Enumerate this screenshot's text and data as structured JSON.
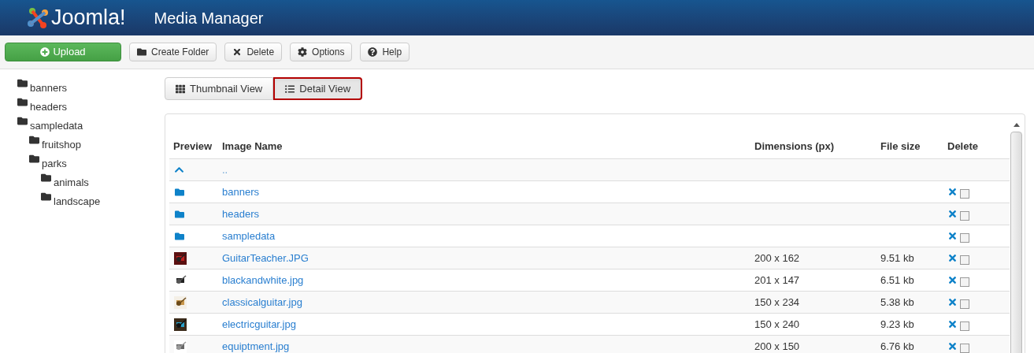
{
  "header": {
    "logo": "Joomla!",
    "title": "Media Manager"
  },
  "toolbar": [
    {
      "kind": "primary",
      "label": "Upload"
    },
    {
      "kind": "default",
      "label": "Create Folder"
    },
    {
      "kind": "default",
      "label": "Delete"
    },
    {
      "kind": "default",
      "label": "Options"
    },
    {
      "kind": "default",
      "label": "Help"
    }
  ],
  "tree": [
    {
      "label": "banners"
    },
    {
      "label": "headers"
    },
    {
      "label": "sampledata",
      "children": [
        {
          "label": "fruitshop"
        },
        {
          "label": "parks",
          "children": [
            {
              "label": "animals"
            },
            {
              "label": "landscape"
            }
          ]
        }
      ]
    }
  ],
  "view_tabs": [
    {
      "label": "Thumbnail View",
      "selected": false
    },
    {
      "label": "Detail View",
      "selected": true
    }
  ],
  "table": {
    "columns": [
      "Preview",
      "Image Name",
      "Dimensions (px)",
      "File size",
      "Delete"
    ],
    "rows": [
      {
        "kind": "up",
        "name": ".."
      },
      {
        "kind": "folder",
        "name": "banners",
        "checked": false
      },
      {
        "kind": "folder",
        "name": "headers",
        "checked": false
      },
      {
        "kind": "folder",
        "name": "sampledata",
        "checked": false
      },
      {
        "name": "GuitarTeacher.JPG",
        "dimensions": "200 x 162",
        "size": "9.51 kb",
        "checked": false
      },
      {
        "name": "blackandwhite.jpg",
        "dimensions": "201 x 147",
        "size": "6.51 kb",
        "checked": false
      },
      {
        "name": "classicalguitar.jpg",
        "dimensions": "150 x 234",
        "size": "5.38 kb",
        "checked": false
      },
      {
        "name": "electricguitar.jpg",
        "dimensions": "150 x 240",
        "size": "9.23 kb",
        "checked": false
      },
      {
        "name": "equiptment.jpg",
        "dimensions": "200 x 150",
        "size": "6.76 kb",
        "checked": false
      }
    ]
  }
}
